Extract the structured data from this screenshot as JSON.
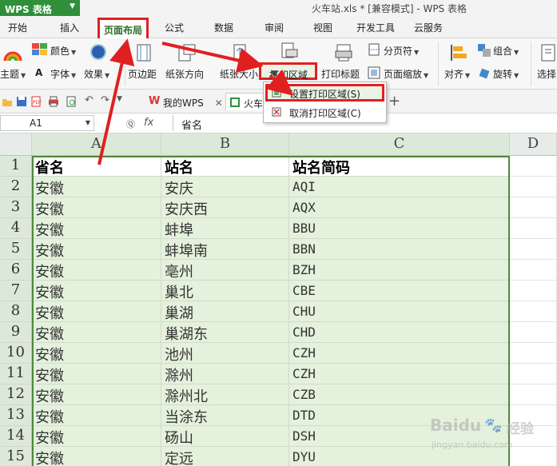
{
  "app": {
    "button_label": "WPS 表格",
    "window_title": "火车站.xls * [兼容模式] - WPS 表格"
  },
  "tabs": [
    "开始",
    "插入",
    "页面布局",
    "公式",
    "数据",
    "审阅",
    "视图",
    "开发工具",
    "云服务"
  ],
  "active_tab": "页面布局",
  "ribbon": {
    "theme": "主题",
    "colors": "颜色",
    "font": "字体",
    "effects": "效果",
    "margins": "页边距",
    "orientation": "纸张方向",
    "size": "纸张大小",
    "print_area": "打印区域",
    "print_titles": "打印标题",
    "page_break": "分页符",
    "page_zoom": "页面缩放",
    "align": "对齐",
    "group": "组合",
    "rotate": "旋转",
    "select": "选择"
  },
  "print_area_menu": {
    "set": "设置打印区域(S)",
    "cancel": "取消打印区域(C)"
  },
  "doc_tabs": {
    "home": "我的WPS",
    "current": "火车"
  },
  "formula_bar": {
    "cell_ref": "A1",
    "fx": "fx",
    "content": "省名"
  },
  "columns": [
    "A",
    "B",
    "C",
    "D"
  ],
  "rows": [
    [
      "省名",
      "站名",
      "站名简码"
    ],
    [
      "安徽",
      "安庆",
      "AQI"
    ],
    [
      "安徽",
      "安庆西",
      "AQX"
    ],
    [
      "安徽",
      "蚌埠",
      "BBU"
    ],
    [
      "安徽",
      "蚌埠南",
      "BBN"
    ],
    [
      "安徽",
      "亳州",
      "BZH"
    ],
    [
      "安徽",
      "巢北",
      "CBE"
    ],
    [
      "安徽",
      "巢湖",
      "CHU"
    ],
    [
      "安徽",
      "巢湖东",
      "CHD"
    ],
    [
      "安徽",
      "池州",
      "CZH"
    ],
    [
      "安徽",
      "滁州",
      "CZH"
    ],
    [
      "安徽",
      "滁州北",
      "CZB"
    ],
    [
      "安徽",
      "当涂东",
      "DTD"
    ],
    [
      "安徽",
      "砀山",
      "DSH"
    ],
    [
      "安徽",
      "定远",
      "DYU"
    ]
  ],
  "watermark": {
    "brand": "Baidu",
    "cn": "经验",
    "url": "jingyan.baidu.com"
  },
  "colors": {
    "wps_green": "#2f8f3a",
    "annotation_red": "#e02020",
    "selection_fill": "#e4f1dd"
  }
}
